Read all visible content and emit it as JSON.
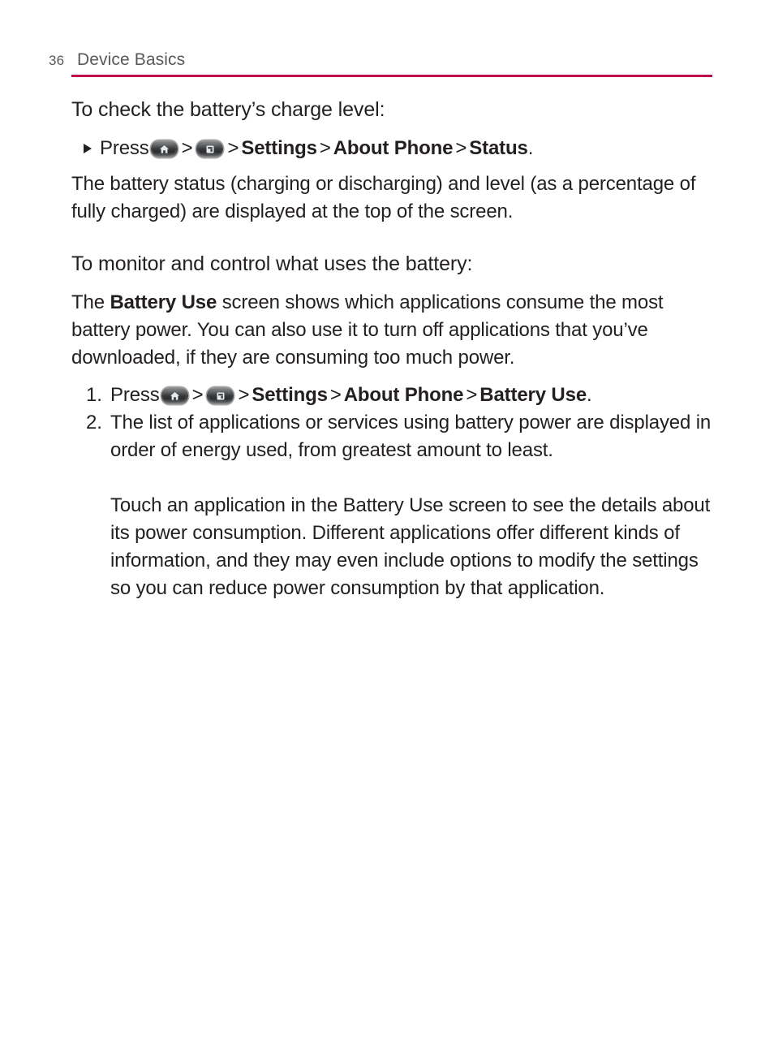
{
  "header": {
    "page_number": "36",
    "title": "Device Basics",
    "rule_color": "#bf0a4d"
  },
  "icons": {
    "home": "home-key-icon",
    "menu": "menu-key-icon",
    "bullet": "triangle-bullet-icon",
    "separator": ">"
  },
  "content": {
    "heading_1": "To check the battery’s charge level:",
    "bullet_1": {
      "press_label": "Press",
      "sep_1": ">",
      "sep_2": ">",
      "settings": "Settings",
      "sep_3": ">",
      "about_phone": "About Phone",
      "sep_4": ">",
      "status": "Status",
      "period": "."
    },
    "paragraph_1": "The battery status (charging or discharging) and level (as a percentage of fully charged) are displayed at the top of the screen.",
    "heading_2": "To monitor and control what uses the battery:",
    "paragraph_2_part1": "The ",
    "paragraph_2_bold": "Battery Use",
    "paragraph_2_part2": " screen shows which applications consume the most battery power. You can also use it to turn off applications that you’ve downloaded, if they are consuming too much power.",
    "list": {
      "item_1": {
        "marker": "1.",
        "press_label": "Press",
        "sep_1": ">",
        "sep_2": ">",
        "settings": "Settings",
        "sep_3": ">",
        "about_phone": "About Phone",
        "sep_4": ">",
        "battery_use": "Battery Use",
        "period": "."
      },
      "item_2": {
        "marker": "2.",
        "text": "The list of applications or services using battery power are displayed in order of energy used, from greatest amount to least."
      }
    },
    "paragraph_3": "Touch an application in the Battery Use screen to see the details about its power consumption. Different applications offer different kinds of information, and they may even include options to modify the settings so you can reduce power consumption by that application."
  }
}
